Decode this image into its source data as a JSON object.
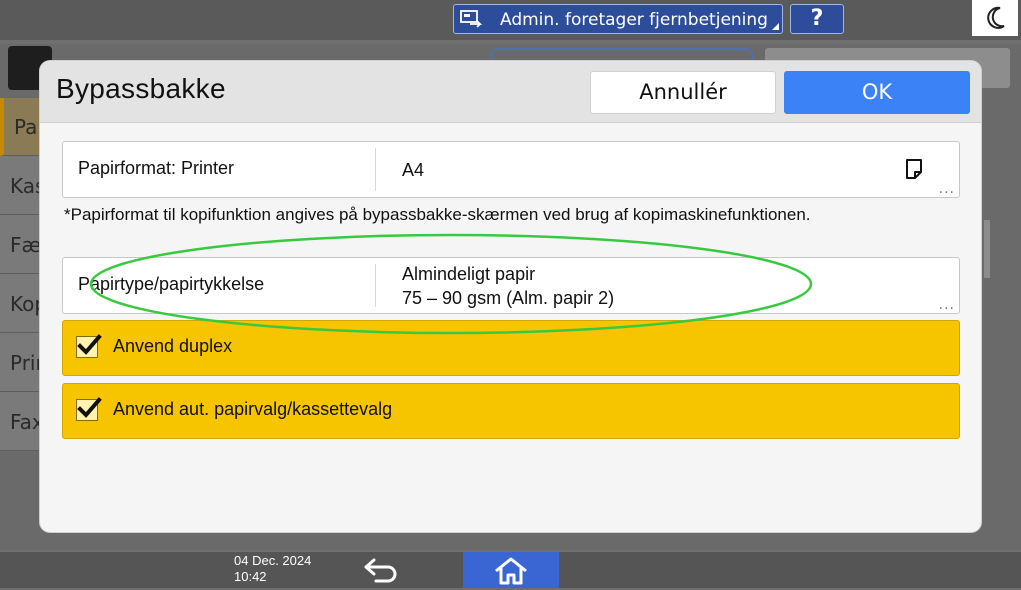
{
  "topbar": {
    "admin_label": "Admin. foretager fjernbetjening",
    "help_label": "?"
  },
  "background": {
    "tabs": [
      "Pap",
      "Kas",
      "Fæl",
      "Kop",
      "Prin",
      "Fax"
    ]
  },
  "modal": {
    "title": "Bypassbakke",
    "cancel_label": "Annullér",
    "ok_label": "OK",
    "paper_format": {
      "label": "Papirformat: Printer",
      "value": "A4"
    },
    "note": "*Papirformat til kopifunktion angives på bypassbakke-skærmen ved brug af kopimaskinefunktionen.",
    "paper_type": {
      "label": "Papirtype/papirtykkelse",
      "value_line1": "Almindeligt papir",
      "value_line2": "75 – 90 gsm (Alm. papir 2)"
    },
    "duplex": {
      "label": "Anvend duplex",
      "checked": true
    },
    "auto_select": {
      "label": "Anvend aut. papirvalg/kassettevalg",
      "checked": true
    },
    "more_indicator": "..."
  },
  "bottombar": {
    "date": "04 Dec. 2024",
    "time": "10:42"
  },
  "colors": {
    "accent": "#3b82f6",
    "check_yellow": "#f7c400",
    "highlight": "#39c940"
  }
}
